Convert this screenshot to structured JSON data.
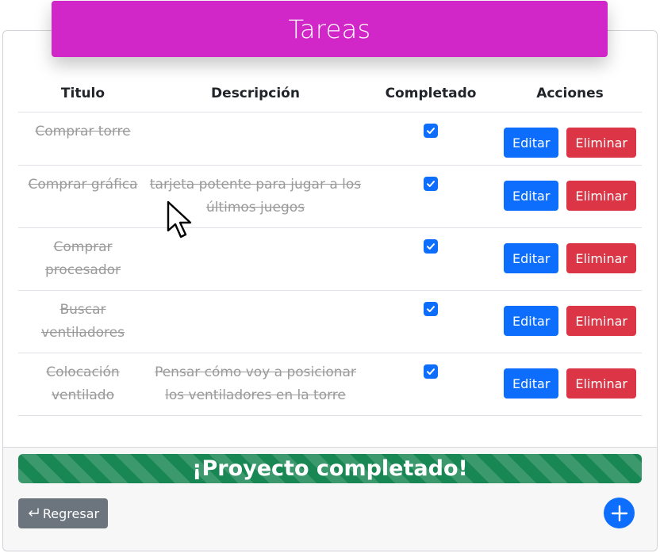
{
  "header": {
    "title": "Tareas"
  },
  "table": {
    "columns": [
      "Titulo",
      "Descripción",
      "Completado",
      "Acciones"
    ],
    "rows": [
      {
        "title": "Comprar torre",
        "description": "",
        "completed": true,
        "edit": "Editar",
        "delete": "Eliminar"
      },
      {
        "title": "Comprar gráfica",
        "description": "tarjeta potente para jugar a los últimos juegos",
        "completed": true,
        "edit": "Editar",
        "delete": "Eliminar"
      },
      {
        "title": "Comprar procesador",
        "description": "",
        "completed": true,
        "edit": "Editar",
        "delete": "Eliminar"
      },
      {
        "title": "Buscar ventiladores",
        "description": "",
        "completed": true,
        "edit": "Editar",
        "delete": "Eliminar"
      },
      {
        "title": "Colocación ventilado",
        "description": "Pensar cómo voy a posicionar los ventiladores en la torre",
        "completed": true,
        "edit": "Editar",
        "delete": "Eliminar"
      }
    ]
  },
  "progress": {
    "label": "¡Proyecto completado!",
    "percent": 100,
    "color": "#198754"
  },
  "footer": {
    "back_label": "Regresar",
    "back_icon": "return-arrow-icon",
    "add_icon": "plus-icon"
  },
  "colors": {
    "header": "#d126c8",
    "primary": "#0d6efd",
    "danger": "#dc3545",
    "secondary": "#6c757d"
  }
}
